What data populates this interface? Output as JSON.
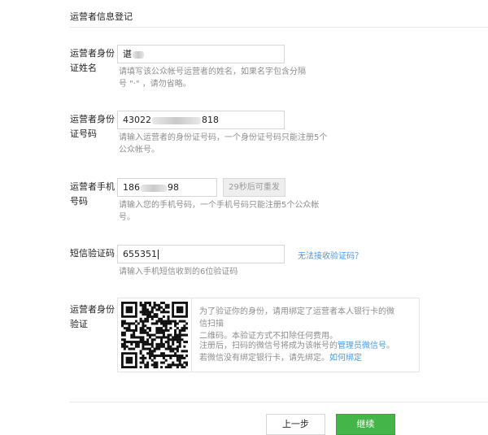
{
  "section_title": "运营者信息登记",
  "fields": {
    "name": {
      "label_line1": "运营者身份",
      "label_line2": "证姓名",
      "value": "谌",
      "hint_line1": "请填写该公众帐号运营者的姓名，如果名字包含分隔",
      "hint_line2": "号  \"·\"  ，请勿省略。"
    },
    "id_number": {
      "label_line1": "运营者身份",
      "label_line2": "证号码",
      "value_prefix": "43022",
      "value_suffix": "818",
      "hint_line1": "请输入运营者的身份证号码，一个身份证号码只能注册5个",
      "hint_line2": "公众帐号。"
    },
    "phone": {
      "label_line1": "运营者手机",
      "label_line2": "号码",
      "value_prefix": "186",
      "value_suffix": "98",
      "resend_label": "29秒后可重发",
      "hint_line1": "请输入您的手机号码，一个手机号码只能注册5个公众帐",
      "hint_line2": "号。"
    },
    "sms_code": {
      "label": "短信验证码",
      "value": "655351",
      "help_link": "无法接收验证码？",
      "hint": "请输入手机短信收到的6位验证码"
    },
    "verify": {
      "label_line1": "运营者身份",
      "label_line2": "验证",
      "text1_line1": "为了验证你的身份，请用绑定了运营者本人银行卡的微信扫描",
      "text1_line2": "二维码。本验证方式不扣除任何费用。",
      "text2_line1_pre": "注册后，扫码的微信号将成为该帐号的",
      "text2_link1": "管理员微信号",
      "text2_line1_post": "。",
      "text2_line2_pre": "若微信没有绑定银行卡，请先绑定。",
      "text2_link2": "如何绑定"
    }
  },
  "buttons": {
    "prev": "上一步",
    "next": "继续"
  },
  "colors": {
    "link": "#459ae9",
    "primary": "#44b549",
    "hint": "#8d8d8d"
  }
}
